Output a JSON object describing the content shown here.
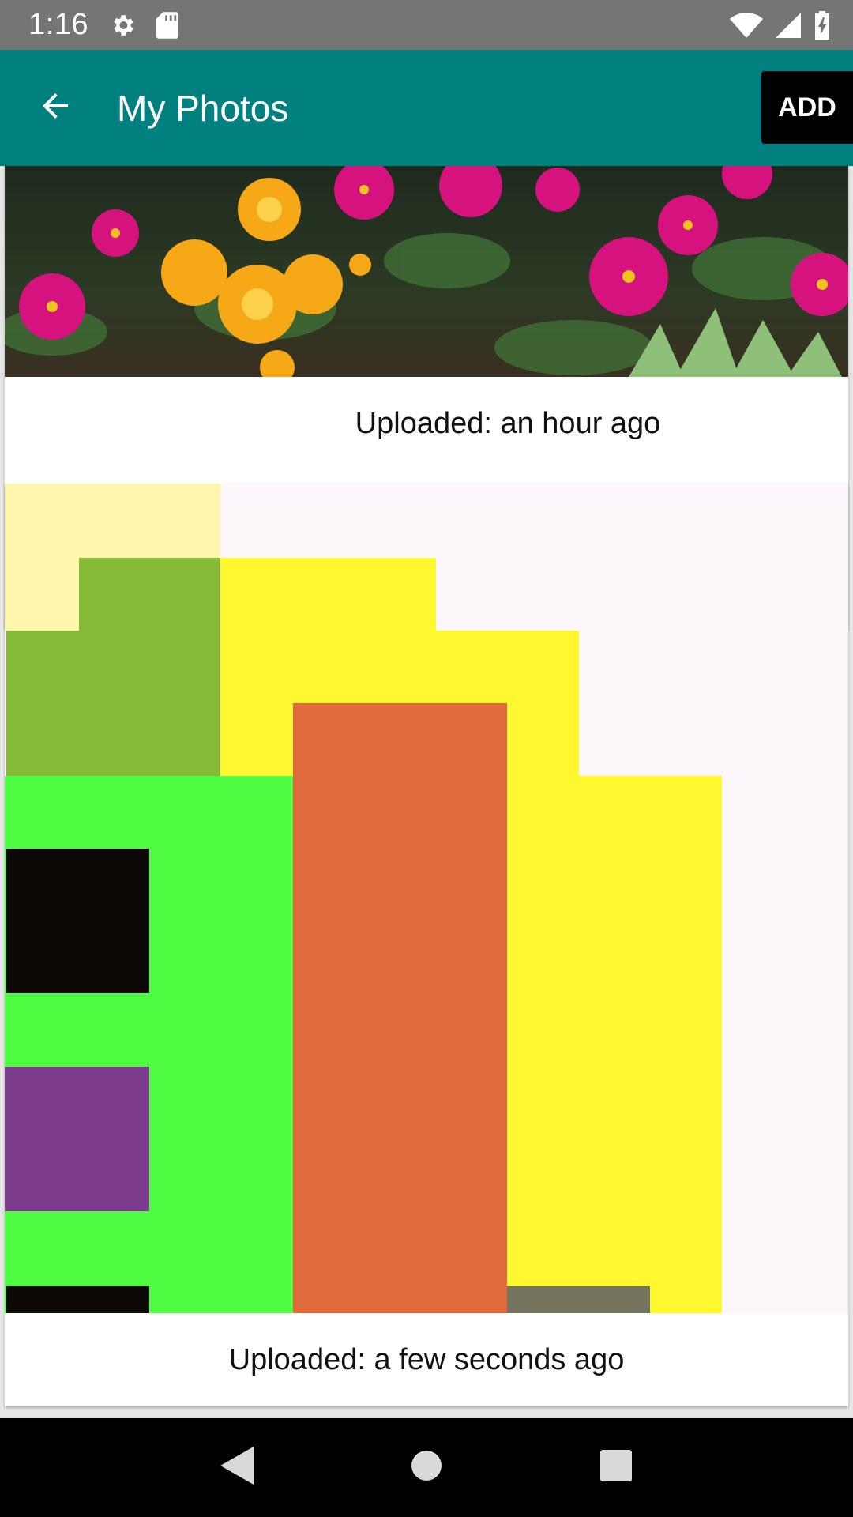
{
  "status_bar": {
    "time": "1:16",
    "icons": [
      "gear-icon",
      "sd-card-icon",
      "wifi-icon",
      "signal-icon",
      "battery-icon"
    ]
  },
  "app_bar": {
    "title": "My Photos",
    "add_label": "ADD",
    "back_icon": "arrow-back-icon",
    "color": "#00807f"
  },
  "photos": [
    {
      "caption": "Uploaded: an hour ago",
      "image": "flowers"
    },
    {
      "caption": "Uploaded: a few seconds ago",
      "image": "pixel-art"
    }
  ],
  "nav_bar": {
    "icons": [
      "back-triangle-icon",
      "home-circle-icon",
      "recents-square-icon"
    ]
  }
}
